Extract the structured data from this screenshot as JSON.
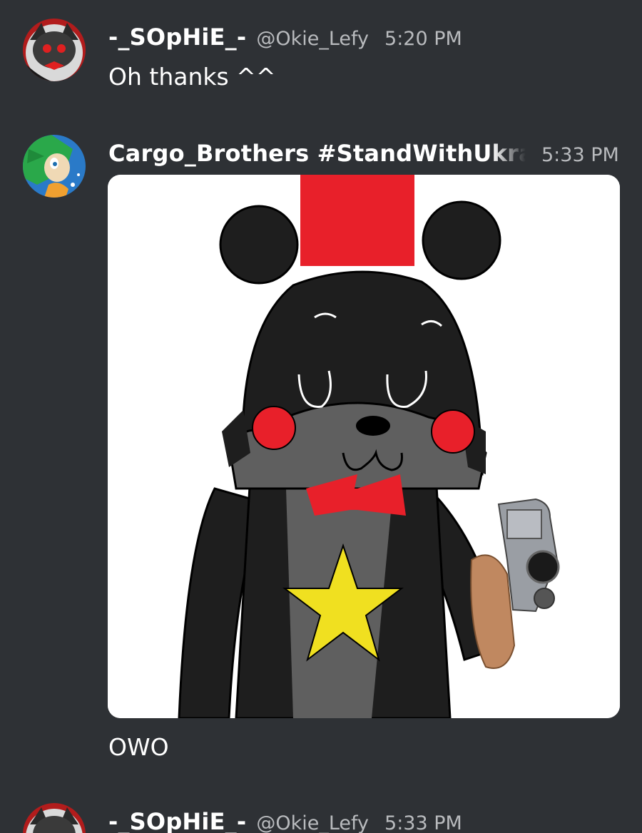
{
  "messages": [
    {
      "username": "-_SOpHiE_-",
      "handle": "@Okie_Lefy",
      "time": "5:20 PM",
      "text": "Oh thanks ^^",
      "avatar_icon": "sophie-avatar"
    },
    {
      "username": "Cargo_Brothers #StandWithUkraine",
      "time": "5:33 PM",
      "attachment_icon": "bear-with-gun-drawing",
      "text": "OWO",
      "avatar_icon": "green-hedgehog-avatar"
    },
    {
      "username": "-_SOpHiE_-",
      "handle": "@Okie_Lefy",
      "time": "5:33 PM",
      "avatar_icon": "sophie-avatar"
    }
  ],
  "colors": {
    "background": "#2e3135",
    "timestamp": "#b9bbbe",
    "text": "#ffffff"
  }
}
